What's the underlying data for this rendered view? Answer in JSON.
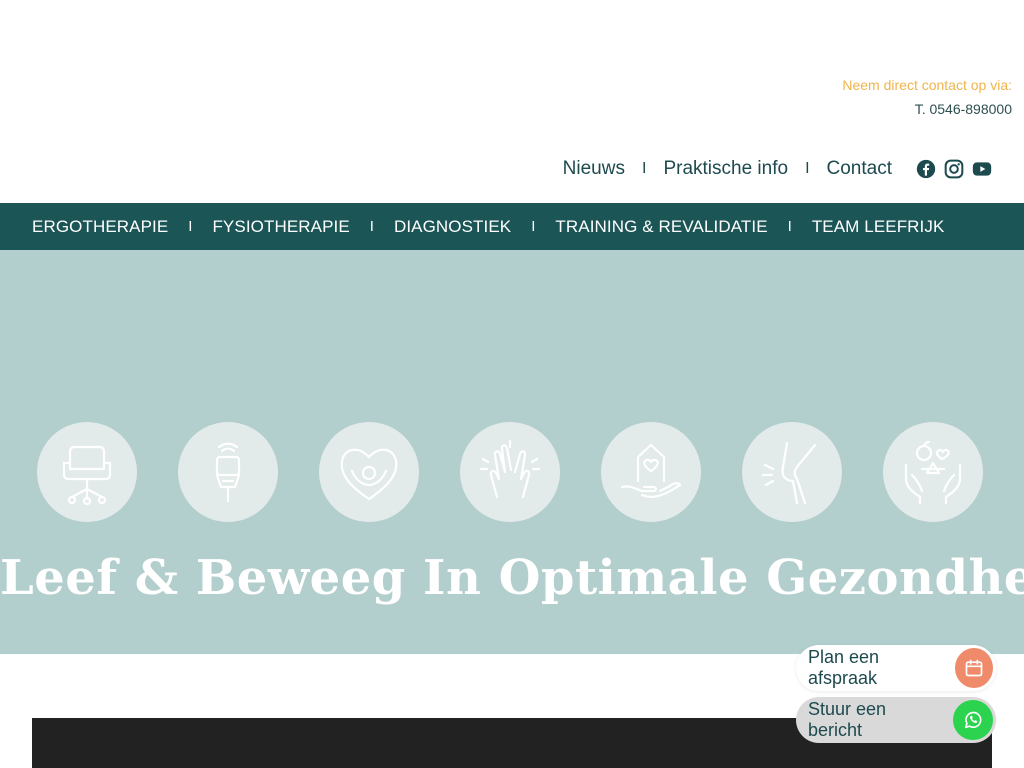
{
  "contact": {
    "label": "Neem direct contact op via:",
    "phone": "T. 0546-898000"
  },
  "topnav": {
    "items": [
      "Nieuws",
      "Praktische info",
      "Contact"
    ],
    "separator": "I"
  },
  "mainnav": {
    "items": [
      "ERGOTHERAPIE",
      "FYSIOTHERAPIE",
      "DIAGNOSTIEK",
      "TRAINING & REVALIDATIE",
      "TEAM LEEFRIJK"
    ],
    "separator": "I"
  },
  "hero": {
    "title": "Leef & Beweeg In Optimale Gezondheid!",
    "icons": [
      "office-chair-icon",
      "ultrasound-device-icon",
      "heart-hands-icon",
      "high-five-icon",
      "house-heart-hand-icon",
      "knee-joint-icon",
      "healthy-food-hands-icon"
    ]
  },
  "actions": {
    "appointment": "Plan een afspraak",
    "message": "Stuur een bericht"
  },
  "colors": {
    "accent": "#f0b44c",
    "nav_bg": "#1b5556",
    "hero_bg": "#b2cecd",
    "calendar_btn": "#ef8a6a",
    "whatsapp_btn": "#2bd34f"
  }
}
